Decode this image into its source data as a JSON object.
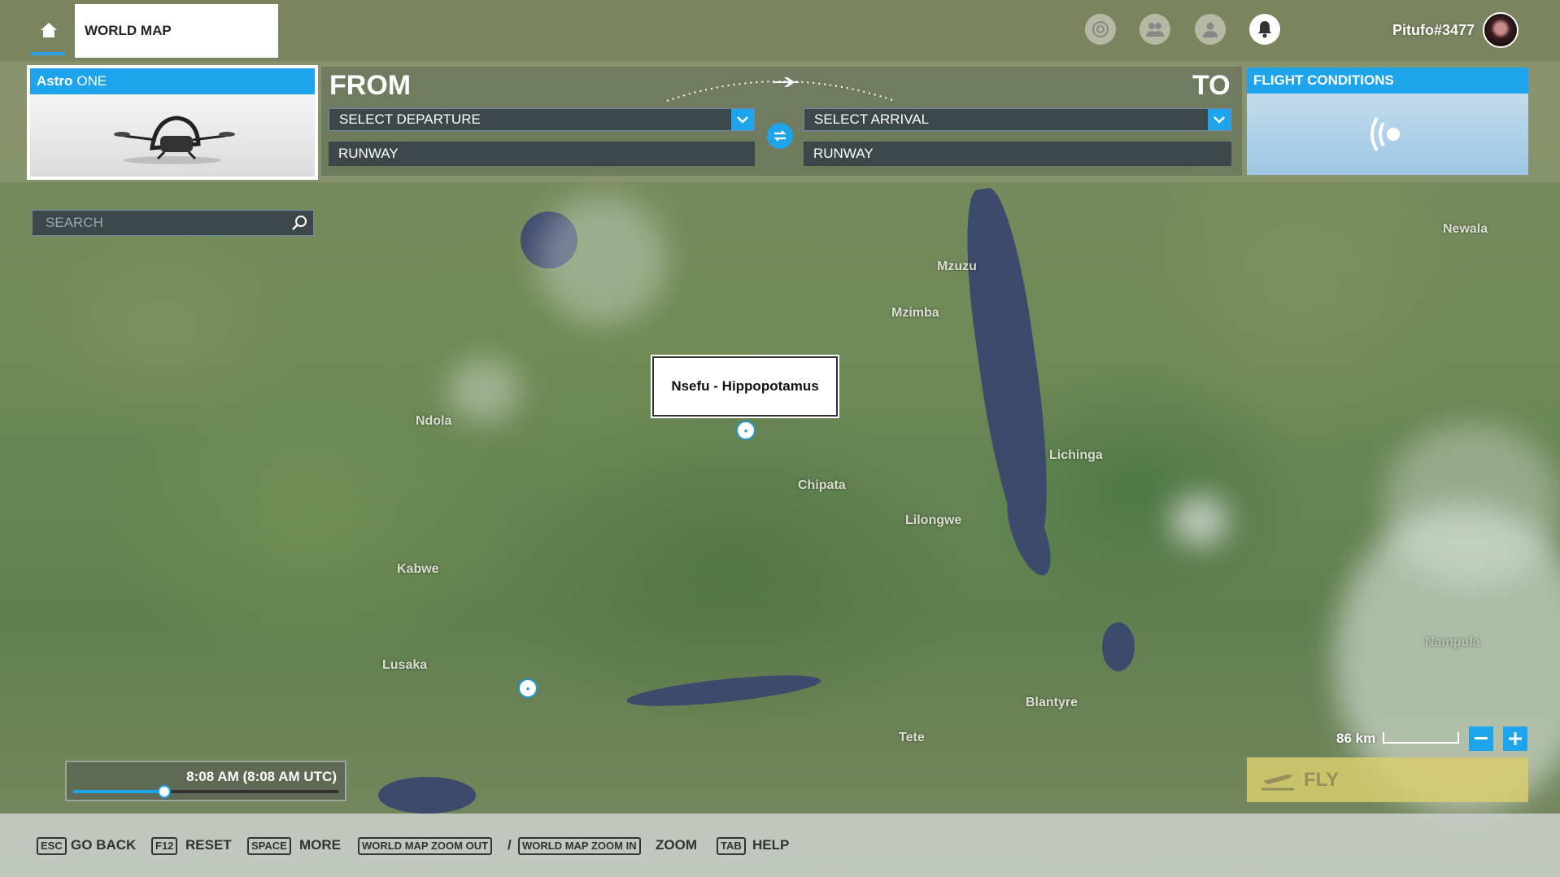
{
  "header": {
    "world_map_tab": "WORLD MAP",
    "username": "Pitufo#3477",
    "icons": [
      "home-icon",
      "achievements-icon",
      "friends-icon",
      "profile-icon",
      "notifications-icon"
    ]
  },
  "aircraft": {
    "brand": "Astro",
    "model": "ONE"
  },
  "route": {
    "from_label": "FROM",
    "to_label": "TO",
    "departure_placeholder": "SELECT DEPARTURE",
    "arrival_placeholder": "SELECT ARRIVAL",
    "departure_runway": "RUNWAY",
    "arrival_runway": "RUNWAY"
  },
  "flight_conditions": {
    "title": "FLIGHT CONDITIONS"
  },
  "search": {
    "placeholder": "SEARCH"
  },
  "map": {
    "selected_poi": "Nsefu - Hippopotamus",
    "towns": [
      "Newala",
      "Mzuzu",
      "Mzimba",
      "Ndola",
      "Lichinga",
      "Chipata",
      "Lilongwe",
      "Kabwe",
      "Lusaka",
      "Blantyre",
      "Tete",
      "Nampula"
    ],
    "scale": "86 km"
  },
  "time": {
    "label": "8:08 AM (8:08 AM UTC)",
    "position_fraction": 0.34
  },
  "fly_button": "FLY",
  "bottom_bar": {
    "esc_key": "ESC",
    "esc_label": "GO BACK",
    "f12_key": "F12",
    "f12_label": "RESET",
    "space_key": "SPACE",
    "space_label": "MORE",
    "zoom_out_key": "WORLD MAP ZOOM OUT",
    "separator": "/",
    "zoom_in_key": "WORLD MAP ZOOM IN",
    "zoom_label": "ZOOM",
    "tab_key": "TAB",
    "tab_label": "HELP"
  },
  "colors": {
    "accent": "#1ea4ec",
    "fly": "#d7cd6e"
  }
}
